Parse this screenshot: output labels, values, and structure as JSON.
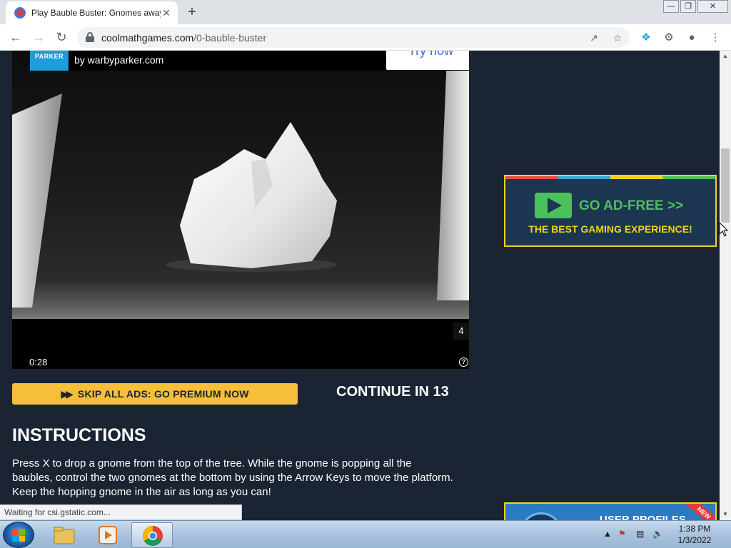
{
  "browser": {
    "tab_title": "Play Bauble Buster: Gnomes away",
    "tab_close": "✕",
    "new_tab": "+",
    "url_domain": "coolmathgames.com",
    "url_path": "/0-bauble-buster",
    "window_controls": [
      "—",
      "❐",
      "✕"
    ],
    "icons": {
      "back": "back-arrow-icon",
      "forward": "forward-arrow-icon",
      "reload": "reload-icon",
      "lock": "lock-icon",
      "share": "share-icon",
      "star": "bookmark-star-icon",
      "extension": "extension-icon",
      "puzzle": "puzzle-icon",
      "profile": "profile-icon",
      "menu": "menu-dots-icon"
    }
  },
  "ad": {
    "logo_text": "PARKER",
    "sponsor": "by warbyparker.com",
    "cta": "Try now",
    "time": "0:28",
    "count": "4",
    "help": "?"
  },
  "game": {
    "skip_ads_label": "SKIP ALL ADS: GO PREMIUM NOW",
    "continue_label": "CONTINUE IN 13",
    "instructions_title": "INSTRUCTIONS",
    "instructions_text": "Press X to drop a gnome from the top of the tree. While the gnome is popping all the baubles, control the two gnomes at the bottom by using the Arrow Keys to move the platform. Keep the hopping gnome in the air as long as you can!"
  },
  "promo": {
    "title": "GO AD-FREE >>",
    "subtitle": "THE BEST GAMING EXPERIENCE!",
    "second_text": "USER PROFILES",
    "badge": "NEW"
  },
  "status_text": "Waiting for csi.gstatic.com...",
  "taskbar": {
    "time": "1:38 PM",
    "date": "1/3/2022"
  },
  "colors": {
    "page_bg": "#1b2432",
    "accent_yellow": "#f5be3b",
    "promo_green": "#4cc05a",
    "promo_yellow": "#f1d21a"
  }
}
